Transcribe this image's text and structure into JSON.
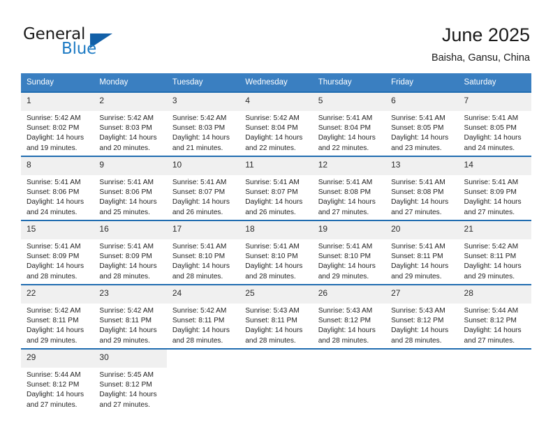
{
  "brand": {
    "name_top": "General",
    "name_bottom": "Blue",
    "triangle_icon": "triangle-logo-icon",
    "color_blue": "#1e7bc4",
    "color_triangle": "#1260a8"
  },
  "header": {
    "month_title": "June 2025",
    "location": "Baisha, Gansu, China"
  },
  "calendar": {
    "accent_header_color": "#3a7fc1",
    "row_divider_color": "#1f6cb0",
    "daynum_background": "#f0f0f0",
    "weekday_headers": [
      "Sunday",
      "Monday",
      "Tuesday",
      "Wednesday",
      "Thursday",
      "Friday",
      "Saturday"
    ],
    "weeks": [
      [
        {
          "day": "1",
          "sunrise": "Sunrise: 5:42 AM",
          "sunset": "Sunset: 8:02 PM",
          "daylight_1": "Daylight: 14 hours",
          "daylight_2": "and 19 minutes."
        },
        {
          "day": "2",
          "sunrise": "Sunrise: 5:42 AM",
          "sunset": "Sunset: 8:03 PM",
          "daylight_1": "Daylight: 14 hours",
          "daylight_2": "and 20 minutes."
        },
        {
          "day": "3",
          "sunrise": "Sunrise: 5:42 AM",
          "sunset": "Sunset: 8:03 PM",
          "daylight_1": "Daylight: 14 hours",
          "daylight_2": "and 21 minutes."
        },
        {
          "day": "4",
          "sunrise": "Sunrise: 5:42 AM",
          "sunset": "Sunset: 8:04 PM",
          "daylight_1": "Daylight: 14 hours",
          "daylight_2": "and 22 minutes."
        },
        {
          "day": "5",
          "sunrise": "Sunrise: 5:41 AM",
          "sunset": "Sunset: 8:04 PM",
          "daylight_1": "Daylight: 14 hours",
          "daylight_2": "and 22 minutes."
        },
        {
          "day": "6",
          "sunrise": "Sunrise: 5:41 AM",
          "sunset": "Sunset: 8:05 PM",
          "daylight_1": "Daylight: 14 hours",
          "daylight_2": "and 23 minutes."
        },
        {
          "day": "7",
          "sunrise": "Sunrise: 5:41 AM",
          "sunset": "Sunset: 8:05 PM",
          "daylight_1": "Daylight: 14 hours",
          "daylight_2": "and 24 minutes."
        }
      ],
      [
        {
          "day": "8",
          "sunrise": "Sunrise: 5:41 AM",
          "sunset": "Sunset: 8:06 PM",
          "daylight_1": "Daylight: 14 hours",
          "daylight_2": "and 24 minutes."
        },
        {
          "day": "9",
          "sunrise": "Sunrise: 5:41 AM",
          "sunset": "Sunset: 8:06 PM",
          "daylight_1": "Daylight: 14 hours",
          "daylight_2": "and 25 minutes."
        },
        {
          "day": "10",
          "sunrise": "Sunrise: 5:41 AM",
          "sunset": "Sunset: 8:07 PM",
          "daylight_1": "Daylight: 14 hours",
          "daylight_2": "and 26 minutes."
        },
        {
          "day": "11",
          "sunrise": "Sunrise: 5:41 AM",
          "sunset": "Sunset: 8:07 PM",
          "daylight_1": "Daylight: 14 hours",
          "daylight_2": "and 26 minutes."
        },
        {
          "day": "12",
          "sunrise": "Sunrise: 5:41 AM",
          "sunset": "Sunset: 8:08 PM",
          "daylight_1": "Daylight: 14 hours",
          "daylight_2": "and 27 minutes."
        },
        {
          "day": "13",
          "sunrise": "Sunrise: 5:41 AM",
          "sunset": "Sunset: 8:08 PM",
          "daylight_1": "Daylight: 14 hours",
          "daylight_2": "and 27 minutes."
        },
        {
          "day": "14",
          "sunrise": "Sunrise: 5:41 AM",
          "sunset": "Sunset: 8:09 PM",
          "daylight_1": "Daylight: 14 hours",
          "daylight_2": "and 27 minutes."
        }
      ],
      [
        {
          "day": "15",
          "sunrise": "Sunrise: 5:41 AM",
          "sunset": "Sunset: 8:09 PM",
          "daylight_1": "Daylight: 14 hours",
          "daylight_2": "and 28 minutes."
        },
        {
          "day": "16",
          "sunrise": "Sunrise: 5:41 AM",
          "sunset": "Sunset: 8:09 PM",
          "daylight_1": "Daylight: 14 hours",
          "daylight_2": "and 28 minutes."
        },
        {
          "day": "17",
          "sunrise": "Sunrise: 5:41 AM",
          "sunset": "Sunset: 8:10 PM",
          "daylight_1": "Daylight: 14 hours",
          "daylight_2": "and 28 minutes."
        },
        {
          "day": "18",
          "sunrise": "Sunrise: 5:41 AM",
          "sunset": "Sunset: 8:10 PM",
          "daylight_1": "Daylight: 14 hours",
          "daylight_2": "and 28 minutes."
        },
        {
          "day": "19",
          "sunrise": "Sunrise: 5:41 AM",
          "sunset": "Sunset: 8:10 PM",
          "daylight_1": "Daylight: 14 hours",
          "daylight_2": "and 29 minutes."
        },
        {
          "day": "20",
          "sunrise": "Sunrise: 5:41 AM",
          "sunset": "Sunset: 8:11 PM",
          "daylight_1": "Daylight: 14 hours",
          "daylight_2": "and 29 minutes."
        },
        {
          "day": "21",
          "sunrise": "Sunrise: 5:42 AM",
          "sunset": "Sunset: 8:11 PM",
          "daylight_1": "Daylight: 14 hours",
          "daylight_2": "and 29 minutes."
        }
      ],
      [
        {
          "day": "22",
          "sunrise": "Sunrise: 5:42 AM",
          "sunset": "Sunset: 8:11 PM",
          "daylight_1": "Daylight: 14 hours",
          "daylight_2": "and 29 minutes."
        },
        {
          "day": "23",
          "sunrise": "Sunrise: 5:42 AM",
          "sunset": "Sunset: 8:11 PM",
          "daylight_1": "Daylight: 14 hours",
          "daylight_2": "and 29 minutes."
        },
        {
          "day": "24",
          "sunrise": "Sunrise: 5:42 AM",
          "sunset": "Sunset: 8:11 PM",
          "daylight_1": "Daylight: 14 hours",
          "daylight_2": "and 28 minutes."
        },
        {
          "day": "25",
          "sunrise": "Sunrise: 5:43 AM",
          "sunset": "Sunset: 8:11 PM",
          "daylight_1": "Daylight: 14 hours",
          "daylight_2": "and 28 minutes."
        },
        {
          "day": "26",
          "sunrise": "Sunrise: 5:43 AM",
          "sunset": "Sunset: 8:12 PM",
          "daylight_1": "Daylight: 14 hours",
          "daylight_2": "and 28 minutes."
        },
        {
          "day": "27",
          "sunrise": "Sunrise: 5:43 AM",
          "sunset": "Sunset: 8:12 PM",
          "daylight_1": "Daylight: 14 hours",
          "daylight_2": "and 28 minutes."
        },
        {
          "day": "28",
          "sunrise": "Sunrise: 5:44 AM",
          "sunset": "Sunset: 8:12 PM",
          "daylight_1": "Daylight: 14 hours",
          "daylight_2": "and 27 minutes."
        }
      ],
      [
        {
          "day": "29",
          "sunrise": "Sunrise: 5:44 AM",
          "sunset": "Sunset: 8:12 PM",
          "daylight_1": "Daylight: 14 hours",
          "daylight_2": "and 27 minutes."
        },
        {
          "day": "30",
          "sunrise": "Sunrise: 5:45 AM",
          "sunset": "Sunset: 8:12 PM",
          "daylight_1": "Daylight: 14 hours",
          "daylight_2": "and 27 minutes."
        },
        {
          "day": "",
          "sunrise": "",
          "sunset": "",
          "daylight_1": "",
          "daylight_2": ""
        },
        {
          "day": "",
          "sunrise": "",
          "sunset": "",
          "daylight_1": "",
          "daylight_2": ""
        },
        {
          "day": "",
          "sunrise": "",
          "sunset": "",
          "daylight_1": "",
          "daylight_2": ""
        },
        {
          "day": "",
          "sunrise": "",
          "sunset": "",
          "daylight_1": "",
          "daylight_2": ""
        },
        {
          "day": "",
          "sunrise": "",
          "sunset": "",
          "daylight_1": "",
          "daylight_2": ""
        }
      ]
    ]
  }
}
